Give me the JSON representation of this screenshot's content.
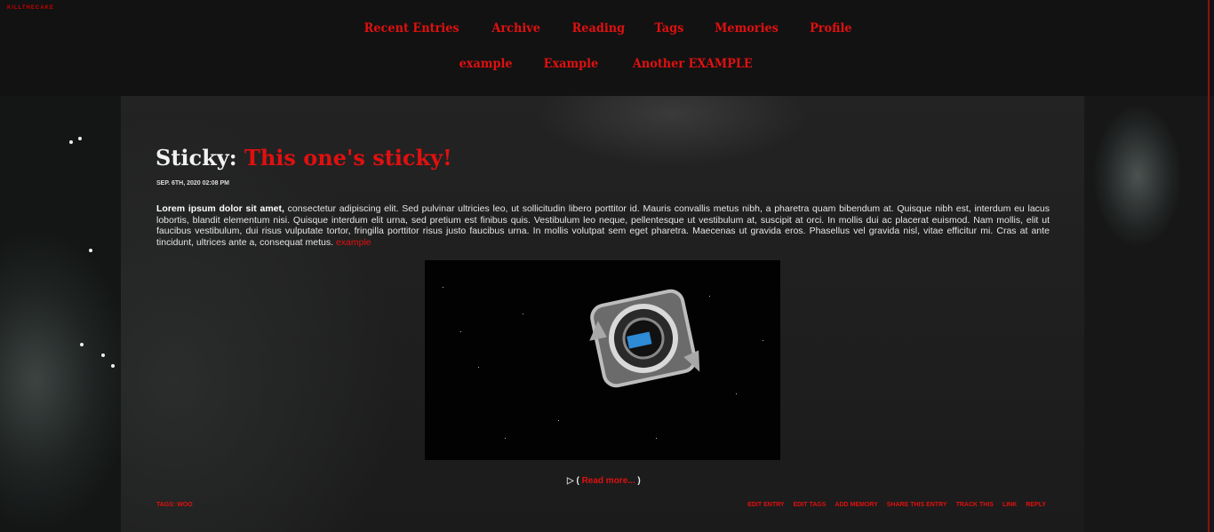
{
  "site": {
    "name": "KILLTHECAKE"
  },
  "nav": {
    "row1": [
      "Recent Entries",
      "Archive",
      "Reading",
      "Tags",
      "Memories",
      "Profile"
    ],
    "row2": [
      "example",
      "Example",
      "Another EXAMPLE"
    ]
  },
  "entry": {
    "title_prefix": "Sticky:",
    "title": "This one's sticky!",
    "date": "SEP. 6TH, 2020 02:08 PM",
    "body_lead": "Lorem ipsum dolor sit amet,",
    "body_text": " consectetur adipiscing elit. Sed pulvinar ultricies leo, ut sollicitudin libero porttitor id. Mauris convallis metus nibh, a pharetra quam bibendum at. Quisque nibh est, interdum eu lacus lobortis, blandit elementum nisi. Quisque interdum elit urna, sed pretium est finibus quis. Vestibulum leo neque, pellentesque ut vestibulum at, suscipit at orci. In mollis dui ac placerat euismod. Nam mollis, elit ut faucibus vestibulum, dui risus vulputate tortor, fringilla porttitor risus justo faucibus urna. In mollis volutpat sem eget pharetra. Maecenas ut gravida eros. Phasellus vel gravida nisl, vitae efficitur mi. Cras at ante tincidunt, ultrices ante a, consequat metus.",
    "body_link": "example",
    "read_more_open": "( ",
    "read_more": "Read more...",
    "read_more_close": " )",
    "tags": "TAGS: WOO",
    "actions": [
      "EDIT ENTRY",
      "EDIT TAGS",
      "ADD MEMORY",
      "SHARE THIS ENTRY",
      "TRACK THIS",
      "LINK",
      "REPLY"
    ]
  },
  "colors": {
    "accent": "#e01010",
    "background": "#141414"
  }
}
